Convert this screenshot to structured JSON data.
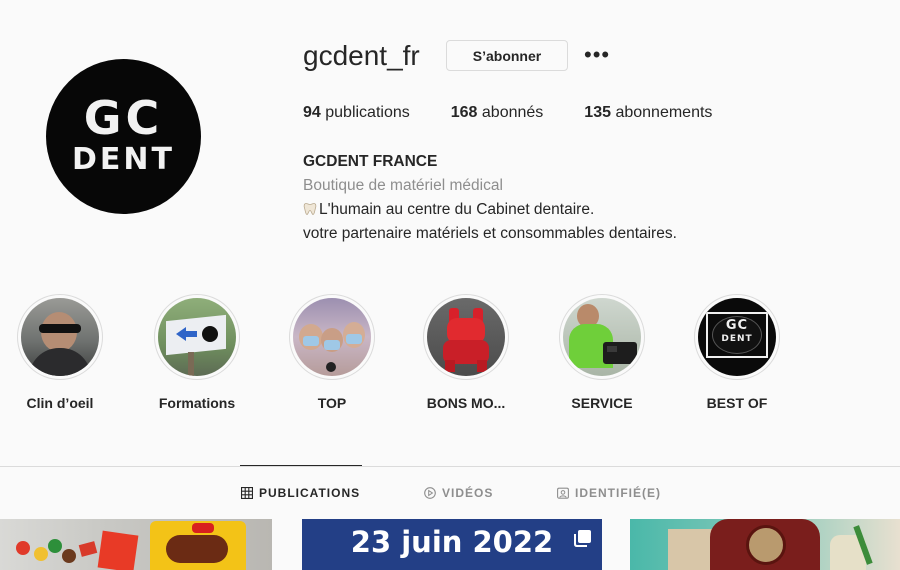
{
  "profile": {
    "username": "gcdent_fr",
    "follow_label": "S’abonner",
    "more_label": "•••",
    "avatar_text": {
      "line1": "GC",
      "line2": "DENT"
    }
  },
  "stats": [
    {
      "count": "94",
      "label": "publications"
    },
    {
      "count": "168",
      "label": "abonnés"
    },
    {
      "count": "135",
      "label": "abonnements"
    }
  ],
  "bio": {
    "name": "GCDENT FRANCE",
    "category": "Boutique de matériel médical",
    "line1": "L'humain au centre du Cabinet dentaire.",
    "line2": "votre partenaire matériels et consommables dentaires."
  },
  "highlights": [
    {
      "label": "Clin d’oeil",
      "icon": "person-in-car-photo"
    },
    {
      "label": "Formations",
      "icon": "arrow-sign-photo"
    },
    {
      "label": "TOP",
      "icon": "team-selfie-photo"
    },
    {
      "label": "BONS MO...",
      "icon": "red-dog-figure-photo"
    },
    {
      "label": "SERVICE",
      "icon": "technician-photo"
    },
    {
      "label": "BEST OF",
      "icon": "gc-dent-logo"
    }
  ],
  "tabs": [
    {
      "label": "PUBLICATIONS",
      "icon": "grid-icon",
      "active": true
    },
    {
      "label": "VIDÉOS",
      "icon": "play-icon",
      "active": false
    },
    {
      "label": "IDENTIFIÉ(E)",
      "icon": "tag-icon",
      "active": false
    }
  ],
  "posts": [
    {
      "kind": "candy-photo"
    },
    {
      "kind": "date-banner",
      "text": "23 juin 2022"
    },
    {
      "kind": "cafe-photo"
    }
  ],
  "colors": {
    "background": "#fafafa",
    "text": "#262626",
    "muted": "#8e8e8e",
    "border": "#dbdbdb",
    "post_blue": "#1f3d8c"
  }
}
